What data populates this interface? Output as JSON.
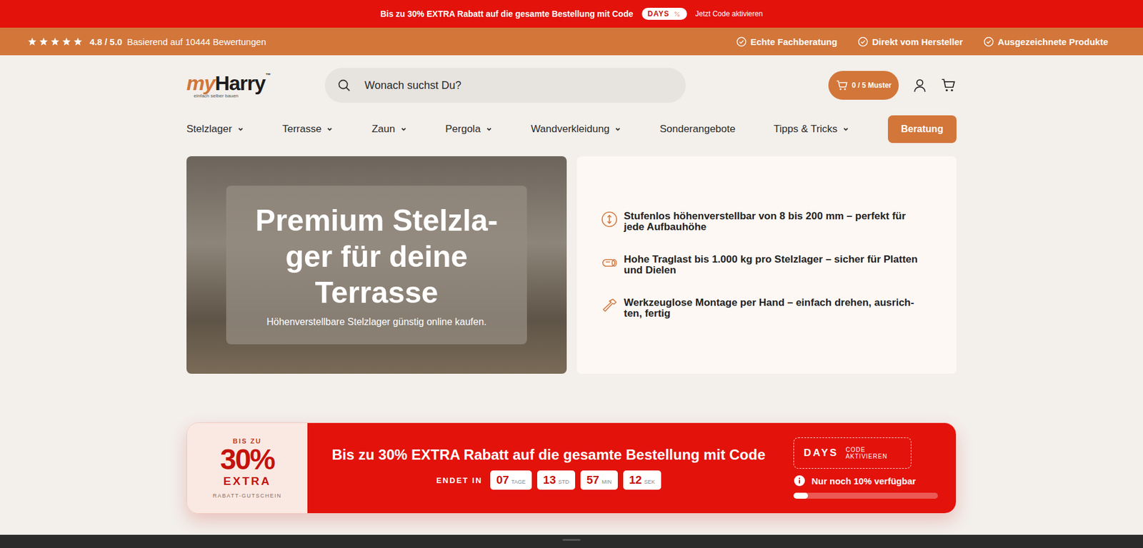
{
  "top_bar": {
    "text": "Bis zu 30% EXTRA Rabatt auf die gesamte Bestellung mit Code",
    "code": "DAYS",
    "link": "Jetzt Code aktivieren"
  },
  "rating_bar": {
    "stars": 5,
    "score": "4.8 / 5.0",
    "reviews": "Basierend auf 10444 Bewertungen",
    "trust_items": [
      "Echte Fachberatung",
      "Direkt vom Hersteller",
      "Ausgezeichnete Produkte"
    ]
  },
  "header": {
    "logo": {
      "prefix": "my",
      "name": "Harry",
      "mark": "™",
      "tagline": "einfach selber bauen"
    },
    "search": {
      "placeholder": "Wonach suchst Du?"
    },
    "samples": "0 / 5 Muster"
  },
  "nav": {
    "items": [
      {
        "label": "Stelzlager",
        "dropdown": true
      },
      {
        "label": "Terrasse",
        "dropdown": true
      },
      {
        "label": "Zaun",
        "dropdown": true
      },
      {
        "label": "Pergola",
        "dropdown": true
      },
      {
        "label": "Wandverkleidung",
        "dropdown": true
      },
      {
        "label": "Sonderangebote",
        "dropdown": false
      },
      {
        "label": "Tipps & Tricks",
        "dropdown": true
      }
    ],
    "cta": "Beratung"
  },
  "hero": {
    "title_lines": [
      "Premium Stelzla-",
      "ger für deine",
      "Terrasse"
    ],
    "subtitle": "Höhenverstellbare Stelzlager günstig online kaufen.",
    "features": [
      {
        "kind": "height",
        "lines": [
          "Stufenlos höhenverstellbar von 8 bis 200 mm – perfekt für",
          "jede Aufbauhöhe"
        ]
      },
      {
        "kind": "load",
        "lines": [
          "Hohe Traglast bis 1.000 kg pro Stelzlager – sicher für Platten",
          "und Dielen"
        ]
      },
      {
        "kind": "tool",
        "lines": [
          "Werkzeuglose Montage per Hand – einfach drehen, ausrich-",
          "ten, fertig"
        ]
      }
    ]
  },
  "promo": {
    "badge_top": "BIS ZU",
    "badge_value": "30%",
    "badge_extra": "EXTRA",
    "badge_bottom": "RABATT-GUTSCHEIN",
    "headline": "Bis zu 30% EXTRA Rabatt auf die gesamte Bestellung mit Code",
    "ends_label": "ENDET IN",
    "countdown": [
      {
        "value": "07",
        "unit": "TAGE"
      },
      {
        "value": "13",
        "unit": "STD"
      },
      {
        "value": "57",
        "unit": "MIN"
      },
      {
        "value": "12",
        "unit": "SEK"
      }
    ],
    "code": "DAYS",
    "code_action": "CODE AKTIVIEREN",
    "availability": "Nur noch 10% verfügbar",
    "level": 0.1
  }
}
